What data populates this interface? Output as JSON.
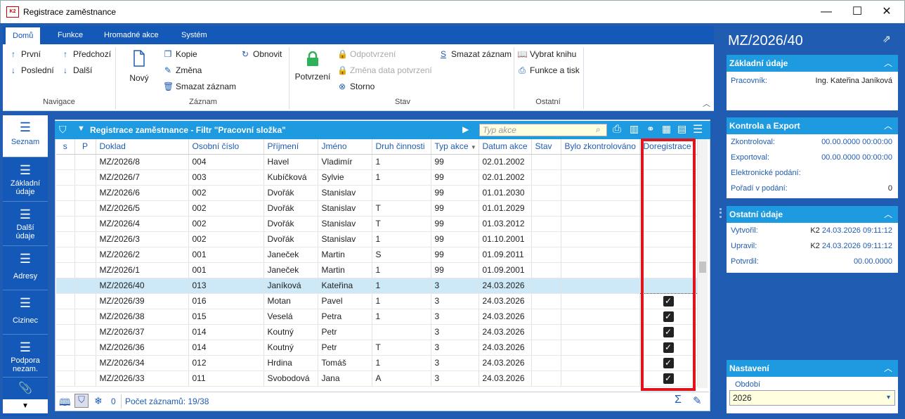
{
  "window": {
    "title": "Registrace zaměstnance",
    "app_badge": "K2",
    "minimize": "—",
    "maximize": "☐",
    "close": "✕"
  },
  "ribbon": {
    "tabs": [
      "Domů",
      "Funkce",
      "Hromadné akce",
      "Systém"
    ],
    "navigace": {
      "label": "Navigace",
      "first": "První",
      "prev": "Předchozí",
      "last": "Poslední",
      "next": "Další"
    },
    "zaznam": {
      "label": "Záznam",
      "new": "Nový",
      "copy": "Kopie",
      "change": "Změna",
      "delete": "Smazat záznam",
      "refresh": "Obnovit"
    },
    "stav": {
      "label": "Stav",
      "confirm": "Potvrzení",
      "unconfirm": "Odpotvrzení",
      "change_date": "Změna data potvrzení",
      "storno": "Storno",
      "delete": "Smazat záznam"
    },
    "ostatni": {
      "label": "Ostatní",
      "choose_book": "Vybrat knihu",
      "functions_print": "Funkce a tisk"
    }
  },
  "leftnav": [
    {
      "label": "Seznam"
    },
    {
      "label": "Základní údaje"
    },
    {
      "label": "Další údaje"
    },
    {
      "label": "Adresy"
    },
    {
      "label": "Cizinec"
    },
    {
      "label": "Podpora nezam."
    }
  ],
  "grid": {
    "title": "Registrace zaměstnance - Filtr \"Pracovní složka\"",
    "search_placeholder": "Typ akce",
    "columns": [
      "s",
      "P",
      "Doklad",
      "Osobní číslo",
      "Příjmení",
      "Jméno",
      "Druh činnosti",
      "Typ akce",
      "Datum akce",
      "Stav",
      "Bylo zkontrolováno",
      "Doregistrace"
    ],
    "rows": [
      {
        "doklad": "MZ/2026/8",
        "osobni": "004",
        "prijmeni": "Havel",
        "jmeno": "Vladimír",
        "druh": "1",
        "typ": "99",
        "datum": "02.01.2002",
        "dore": false
      },
      {
        "doklad": "MZ/2026/7",
        "osobni": "003",
        "prijmeni": "Kubíčková",
        "jmeno": "Sylvie",
        "druh": "1",
        "typ": "99",
        "datum": "02.01.2002",
        "dore": false
      },
      {
        "doklad": "MZ/2026/6",
        "osobni": "002",
        "prijmeni": "Dvořák",
        "jmeno": "Stanislav",
        "druh": "",
        "typ": "99",
        "datum": "01.01.2030",
        "dore": false
      },
      {
        "doklad": "MZ/2026/5",
        "osobni": "002",
        "prijmeni": "Dvořák",
        "jmeno": "Stanislav",
        "druh": "T",
        "typ": "99",
        "datum": "01.01.2029",
        "dore": false
      },
      {
        "doklad": "MZ/2026/4",
        "osobni": "002",
        "prijmeni": "Dvořák",
        "jmeno": "Stanislav",
        "druh": "T",
        "typ": "99",
        "datum": "01.03.2012",
        "dore": false
      },
      {
        "doklad": "MZ/2026/3",
        "osobni": "002",
        "prijmeni": "Dvořák",
        "jmeno": "Stanislav",
        "druh": "1",
        "typ": "99",
        "datum": "01.10.2001",
        "dore": false
      },
      {
        "doklad": "MZ/2026/2",
        "osobni": "001",
        "prijmeni": "Janeček",
        "jmeno": "Martin",
        "druh": "S",
        "typ": "99",
        "datum": "01.09.2011",
        "dore": false
      },
      {
        "doklad": "MZ/2026/1",
        "osobni": "001",
        "prijmeni": "Janeček",
        "jmeno": "Martin",
        "druh": "1",
        "typ": "99",
        "datum": "01.09.2001",
        "dore": false
      },
      {
        "doklad": "MZ/2026/40",
        "osobni": "013",
        "prijmeni": "Janíková",
        "jmeno": "Kateřina",
        "druh": "1",
        "typ": "3",
        "datum": "24.03.2026",
        "dore": false,
        "selected": true
      },
      {
        "doklad": "MZ/2026/39",
        "osobni": "016",
        "prijmeni": "Motan",
        "jmeno": "Pavel",
        "druh": "1",
        "typ": "3",
        "datum": "24.03.2026",
        "dore": true
      },
      {
        "doklad": "MZ/2026/38",
        "osobni": "015",
        "prijmeni": "Veselá",
        "jmeno": "Petra",
        "druh": "1",
        "typ": "3",
        "datum": "24.03.2026",
        "dore": true
      },
      {
        "doklad": "MZ/2026/37",
        "osobni": "014",
        "prijmeni": "Koutný",
        "jmeno": "Petr",
        "druh": "",
        "typ": "3",
        "datum": "24.03.2026",
        "dore": true
      },
      {
        "doklad": "MZ/2026/36",
        "osobni": "014",
        "prijmeni": "Koutný",
        "jmeno": "Petr",
        "druh": "T",
        "typ": "3",
        "datum": "24.03.2026",
        "dore": true
      },
      {
        "doklad": "MZ/2026/34",
        "osobni": "012",
        "prijmeni": "Hrdina",
        "jmeno": "Tomáš",
        "druh": "1",
        "typ": "3",
        "datum": "24.03.2026",
        "dore": true
      },
      {
        "doklad": "MZ/2026/33",
        "osobni": "011",
        "prijmeni": "Svobodová",
        "jmeno": "Jana",
        "druh": "A",
        "typ": "3",
        "datum": "24.03.2026",
        "dore": true
      }
    ],
    "footer": {
      "count_zero": "0",
      "record_count": "Počet záznamů: 19/38"
    }
  },
  "right": {
    "title": "MZ/2026/40",
    "zakladni": {
      "header": "Základní údaje",
      "pracovnik_label": "Pracovník:",
      "pracovnik_value": "Ing. Kateřina Janíková"
    },
    "kontrola": {
      "header": "Kontrola a Export",
      "zkontroloval_label": "Zkontroloval:",
      "zkontroloval_value": "00.00.0000 00:00:00",
      "exportoval_label": "Exportoval:",
      "exportoval_value": "00.00.0000 00:00:00",
      "podani_label": "Elektronické podání:",
      "poradi_label": "Pořadí v podání:",
      "poradi_value": "0"
    },
    "ostatni": {
      "header": "Ostatní údaje",
      "vytvoril_label": "Vytvořil:",
      "vytvoril_user": "K2",
      "vytvoril_value": "24.03.2026 09:11:12",
      "upravil_label": "Upravil:",
      "upravil_user": "K2",
      "upravil_value": "24.03.2026 09:11:12",
      "potvrdil_label": "Potvrdil:",
      "potvrdil_value": "00.00.0000"
    },
    "nastaveni": {
      "header": "Nastavení",
      "obdobi_label": "Období",
      "obdobi_value": "2026"
    }
  }
}
